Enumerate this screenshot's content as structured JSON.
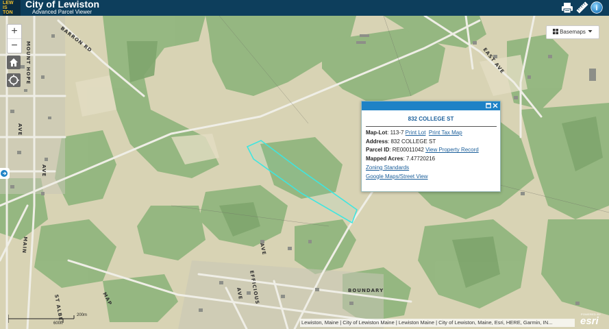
{
  "header": {
    "logo_lines": [
      "LEW",
      "IS",
      "TON"
    ],
    "title": "City of Lewiston",
    "subtitle": "Advanced Parcel Viewer",
    "icons": [
      "print-icon",
      "measure-ruler-icon",
      "help-globe-icon"
    ]
  },
  "map_controls": {
    "zoom_in": "+",
    "zoom_out": "−",
    "home_icon": "home-icon",
    "locate_icon": "locate-icon",
    "basemaps_label": "Basemaps",
    "side_toggle_icon": "arrow-right-icon"
  },
  "streets": [
    "BARRON RD",
    "MOUNT HOPE",
    "AVE",
    "AVE",
    "EAST AVE",
    "AVE",
    "MAIN",
    "EFFICIOUS",
    "AVE",
    "ST ALBE",
    "MAP",
    "BOUNDARY"
  ],
  "popup": {
    "title": "832 COLLEGE ST",
    "map_lot_label": "Map-Lot",
    "map_lot_value": "113-7",
    "print_lot": "Print Lot",
    "print_tax_map": "Print Tax Map",
    "address_label": "Address",
    "address_value": "832 COLLEGE ST",
    "parcel_id_label": "Parcel ID",
    "parcel_id_value": "RE00011042",
    "view_property_record": "View Property Record",
    "mapped_acres_label": "Mapped Acres",
    "mapped_acres_value": "7.47720216",
    "zoning_standards": "Zoning Standards",
    "google_maps": "Google Maps/Street View"
  },
  "scale": {
    "top_label": "200m",
    "bottom_label": "600ft"
  },
  "attribution": "Lewiston, Maine | City of Lewiston Maine | Lewiston Maine | City of Lewiston, Maine, Esri, HERE, Garmin, IN...",
  "esri": {
    "powered_by": "POWERED BY",
    "name": "esri"
  },
  "colors": {
    "header": "#0d3e5c",
    "popup_bar": "#1e82c6",
    "parcel_outline": "#3ee6e0",
    "forest": "#8fb57c",
    "field": "#d9d4b6"
  }
}
